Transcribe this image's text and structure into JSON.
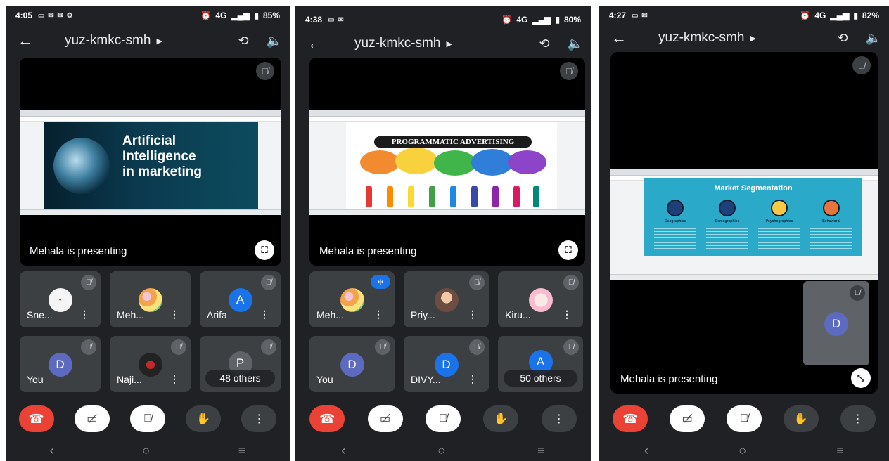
{
  "colors": {
    "background": "#202124",
    "hangup": "#ea4335",
    "avatar_blue": "#1a73e8",
    "avatar_indigo": "#5c6bc0",
    "tile": "#3c4043",
    "slide_cyan": "#2aa9c9"
  },
  "icons": {
    "back": "arrow-left-icon",
    "camera_switch": "camera-switch-icon",
    "speaker": "speaker-icon",
    "mic_off": "mic-off-icon",
    "fullscreen": "fullscreen-icon",
    "exit_fullscreen": "exit-fullscreen-icon",
    "hangup": "phone-hangup-icon",
    "camera_off": "camera-off-icon",
    "hand": "raise-hand-icon",
    "more": "more-vert-icon"
  },
  "phones": [
    {
      "status": {
        "time": "4:05",
        "battery": "85%",
        "network": "4G"
      },
      "meeting_code": "yuz-kmkc-smh",
      "presenting": "Mehala is presenting",
      "slide": {
        "line1": "Artificial",
        "line2": "Intelligence",
        "line3": "in marketing"
      },
      "tiles": [
        {
          "name": "Sne...",
          "avatar": ""
        },
        {
          "name": "Meh...",
          "avatar": ""
        },
        {
          "name": "Arifa",
          "avatar": "A"
        },
        {
          "name": "You",
          "avatar": "D"
        },
        {
          "name": "Naji...",
          "avatar": ""
        },
        {
          "name": "48 others",
          "avatar": "P"
        }
      ]
    },
    {
      "status": {
        "time": "4:38",
        "battery": "80%",
        "network": "4G"
      },
      "meeting_code": "yuz-kmkc-smh",
      "presenting": "Mehala is presenting",
      "slide": {
        "banner": "PROGRAMMATIC ADVERTISING"
      },
      "tiles": [
        {
          "name": "Meh...",
          "avatar": ""
        },
        {
          "name": "Priy...",
          "avatar": ""
        },
        {
          "name": "Kiru...",
          "avatar": ""
        },
        {
          "name": "You",
          "avatar": "D"
        },
        {
          "name": "DIVY...",
          "avatar": "D"
        },
        {
          "name": "50 others",
          "avatar": "A"
        }
      ]
    },
    {
      "status": {
        "time": "4:27",
        "battery": "82%",
        "network": "4G"
      },
      "meeting_code": "yuz-kmkc-smh",
      "presenting": "Mehala is presenting",
      "slide": {
        "title": "Market Segmentation",
        "columns": [
          "Geographics",
          "Demographics",
          "Psychographics",
          "Behavioral"
        ]
      },
      "self_avatar": "D"
    }
  ]
}
